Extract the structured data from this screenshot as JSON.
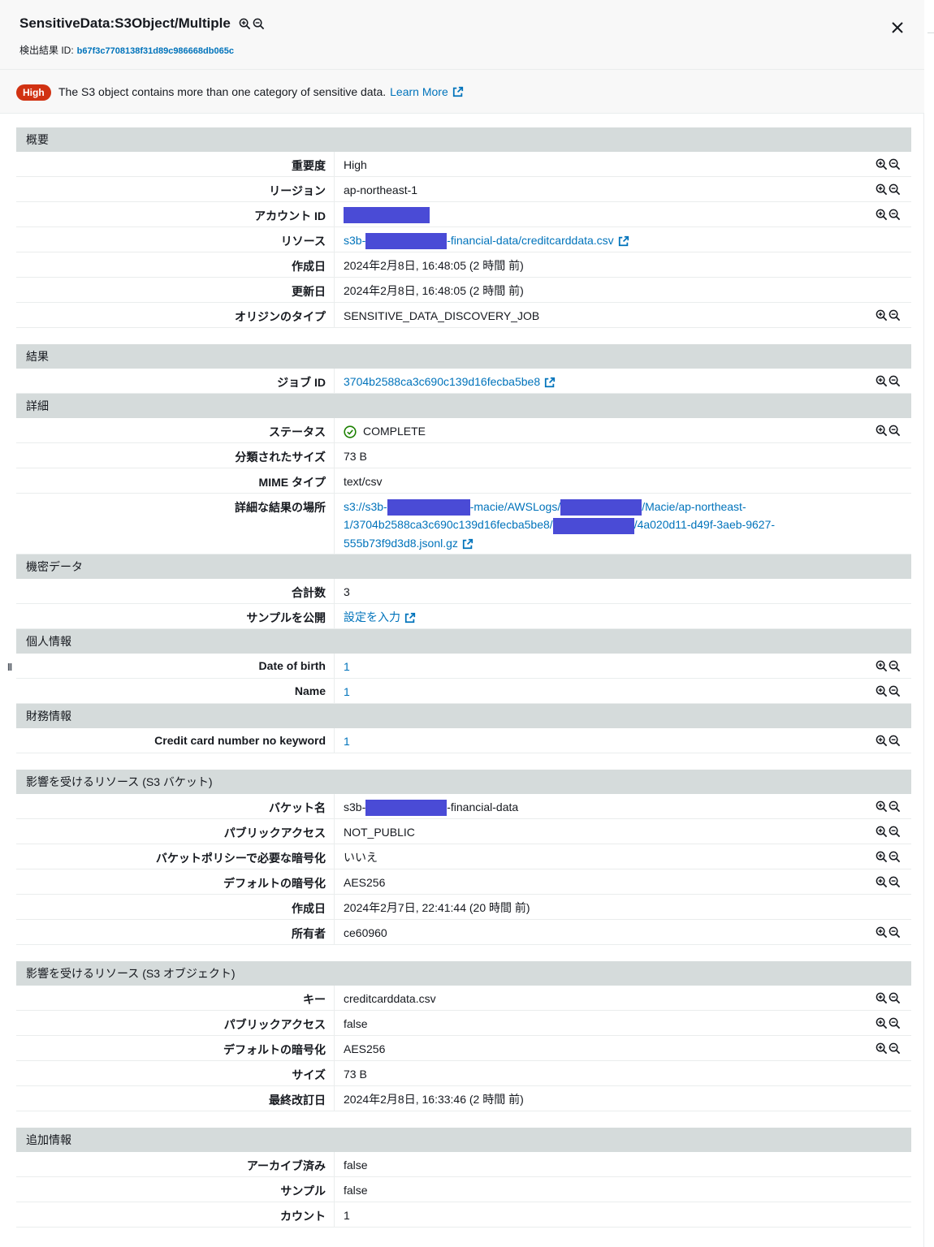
{
  "header": {
    "title": "SensitiveData:S3Object/Multiple",
    "finding_id_label": "検出結果 ID:",
    "finding_id": "b67f3c7708138f31d89c986668db065c"
  },
  "banner": {
    "severity": "High",
    "text": "The S3 object contains more than one category of sensitive data.",
    "link": "Learn More"
  },
  "colors": {
    "accent": "#0073bb",
    "severity_high": "#d13212",
    "section_header_bg": "#d5dbdb",
    "redaction": "#4a4bd6",
    "status_ok": "#1d8102"
  },
  "overview": {
    "title": "概要",
    "severity_label": "重要度",
    "severity": "High",
    "region_label": "リージョン",
    "region": "ap-northeast-1",
    "account_label": "アカウント ID",
    "resource_label": "リソース",
    "resource_prefix": "s3b-",
    "resource_suffix": "-financial-data/creditcarddata.csv",
    "created_label": "作成日",
    "created": "2024年2月8日, 16:48:05 (2 時間 前)",
    "updated_label": "更新日",
    "updated": "2024年2月8日, 16:48:05 (2 時間 前)",
    "origin_label": "オリジンのタイプ",
    "origin": "SENSITIVE_DATA_DISCOVERY_JOB"
  },
  "result": {
    "title": "結果",
    "job_label": "ジョブ ID",
    "job_id": "3704b2588ca3c690c139d16fecba5be8"
  },
  "details": {
    "title": "詳細",
    "status_label": "ステータス",
    "status": "COMPLETE",
    "size_label": "分類されたサイズ",
    "size": "73 B",
    "mime_label": "MIME タイプ",
    "mime": "text/csv",
    "location_label": "詳細な結果の場所",
    "location_part1": "s3://s3b-",
    "location_part2": "-macie/AWSLogs/",
    "location_part3": "/Macie/ap-northeast-",
    "location_part4": "1/3704b2588ca3c690c139d16fecba5be8/",
    "location_part5": "/4a020d11-d49f-3aeb-9627-",
    "location_part6": "555b73f9d3d8.jsonl.gz"
  },
  "sensitive": {
    "title": "機密データ",
    "total_label": "合計数",
    "total": "3",
    "sample_label": "サンプルを公開",
    "sample": "設定を入力"
  },
  "personal": {
    "title": "個人情報",
    "dob_label": "Date of birth",
    "dob": "1",
    "name_label": "Name",
    "name": "1"
  },
  "financial": {
    "title": "財務情報",
    "cc_label": "Credit card number no keyword",
    "cc": "1"
  },
  "bucket": {
    "title": "影響を受けるリソース (S3 バケット)",
    "name_label": "バケット名",
    "name_prefix": "s3b-",
    "name_suffix": "-financial-data",
    "public_label": "パブリックアクセス",
    "public": "NOT_PUBLIC",
    "policy_label": "バケットポリシーで必要な暗号化",
    "policy": "いいえ",
    "enc_label": "デフォルトの暗号化",
    "enc": "AES256",
    "created_label": "作成日",
    "created": "2024年2月7日, 22:41:44 (20 時間 前)",
    "owner_label": "所有者",
    "owner": "ce60960"
  },
  "object": {
    "title": "影響を受けるリソース (S3 オブジェクト)",
    "key_label": "キー",
    "key": "creditcarddata.csv",
    "public_label": "パブリックアクセス",
    "public": "false",
    "enc_label": "デフォルトの暗号化",
    "enc": "AES256",
    "size_label": "サイズ",
    "size": "73 B",
    "modified_label": "最終改訂日",
    "modified": "2024年2月8日, 16:33:46 (2 時間 前)"
  },
  "additional": {
    "title": "追加情報",
    "archived_label": "アーカイブ済み",
    "archived": "false",
    "sample_label": "サンプル",
    "sample": "false",
    "count_label": "カウント",
    "count": "1"
  },
  "handle": "II"
}
